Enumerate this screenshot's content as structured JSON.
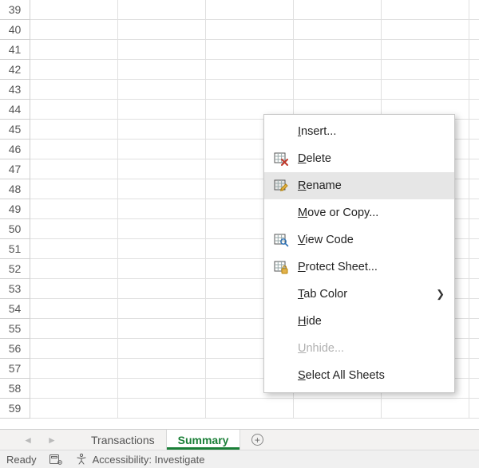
{
  "grid": {
    "row_start": 39,
    "row_end": 59,
    "columns": 6
  },
  "tabs": {
    "items": [
      {
        "label": "Transactions",
        "active": false
      },
      {
        "label": "Summary",
        "active": true
      }
    ]
  },
  "statusbar": {
    "ready": "Ready",
    "accessibility": "Accessibility: Investigate"
  },
  "context_menu": {
    "items": [
      {
        "key": "insert",
        "label": "Insert...",
        "mn": "I",
        "icon": null,
        "enabled": true,
        "submenu": false
      },
      {
        "key": "delete",
        "label": "Delete",
        "mn": "D",
        "icon": "grid-x",
        "enabled": true,
        "submenu": false
      },
      {
        "key": "rename",
        "label": "Rename",
        "mn": "R",
        "icon": "grid-pencil",
        "enabled": true,
        "submenu": false,
        "highlight": true
      },
      {
        "key": "movecopy",
        "label": "Move or Copy...",
        "mn": "M",
        "icon": null,
        "enabled": true,
        "submenu": false
      },
      {
        "key": "viewcode",
        "label": "View Code",
        "mn": "V",
        "icon": "grid-search",
        "enabled": true,
        "submenu": false
      },
      {
        "key": "protect",
        "label": "Protect Sheet...",
        "mn": "P",
        "icon": "grid-lock",
        "enabled": true,
        "submenu": false
      },
      {
        "key": "tabcolor",
        "label": "Tab Color",
        "mn": "T",
        "icon": null,
        "enabled": true,
        "submenu": true
      },
      {
        "key": "hide",
        "label": "Hide",
        "mn": "H",
        "icon": null,
        "enabled": true,
        "submenu": false
      },
      {
        "key": "unhide",
        "label": "Unhide...",
        "mn": "U",
        "icon": null,
        "enabled": false,
        "submenu": false
      },
      {
        "key": "selectall",
        "label": "Select All Sheets",
        "mn": "S",
        "icon": null,
        "enabled": true,
        "submenu": false
      }
    ]
  }
}
